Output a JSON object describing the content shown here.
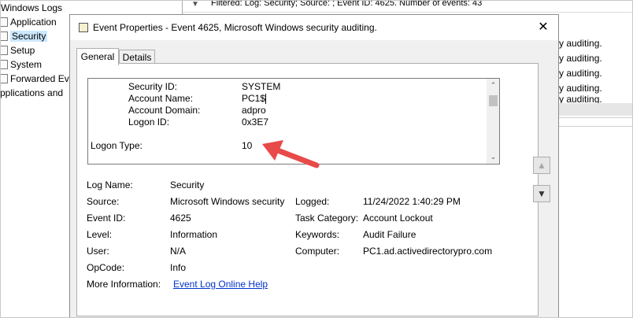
{
  "tree": {
    "title": "Windows Logs",
    "items": [
      {
        "label": "Application"
      },
      {
        "label": "Security"
      },
      {
        "label": "Setup"
      },
      {
        "label": "System"
      },
      {
        "label": "Forwarded Eve"
      }
    ],
    "apps_label": "pplications and"
  },
  "background": {
    "filter_text": "Filtered: Log: Security; Source: ; Event ID: 4625. Number of events: 43",
    "row_text": "y auditing.",
    "row_text_partial": "auditing."
  },
  "dialog": {
    "title": "Event Properties - Event 4625, Microsoft Windows security auditing.",
    "close_glyph": "✕",
    "tabs": [
      {
        "label": "General"
      },
      {
        "label": "Details"
      }
    ],
    "description": {
      "rows": [
        {
          "key": "Security ID:",
          "value": "SYSTEM"
        },
        {
          "key": "Account Name:",
          "value": "PC1$"
        },
        {
          "key": "Account Domain:",
          "value": "adpro"
        },
        {
          "key": "Logon ID:",
          "value": "0x3E7"
        }
      ],
      "logon_type_label": "Logon Type:",
      "logon_type_value": "10"
    },
    "properties": {
      "log_name": {
        "label": "Log Name:",
        "value": "Security"
      },
      "source": {
        "label": "Source:",
        "value": "Microsoft Windows security"
      },
      "logged": {
        "label": "Logged:",
        "value": "11/24/2022 1:40:29 PM"
      },
      "event_id": {
        "label": "Event ID:",
        "value": "4625"
      },
      "task_category": {
        "label": "Task Category:",
        "value": "Account Lockout"
      },
      "level": {
        "label": "Level:",
        "value": "Information"
      },
      "keywords": {
        "label": "Keywords:",
        "value": "Audit Failure"
      },
      "user": {
        "label": "User:",
        "value": "N/A"
      },
      "computer": {
        "label": "Computer:",
        "value": "PC1.ad.activedirectorypro.com"
      },
      "opcode": {
        "label": "OpCode:",
        "value": "Info"
      },
      "more_info": {
        "label": "More Information:",
        "link": "Event Log Online Help"
      }
    },
    "nav": {
      "up_glyph": "▲",
      "down_glyph": "▼"
    }
  },
  "colors": {
    "annotation_arrow": "#e84a4a",
    "link": "#0033cc",
    "selected": "#cce8ff"
  }
}
